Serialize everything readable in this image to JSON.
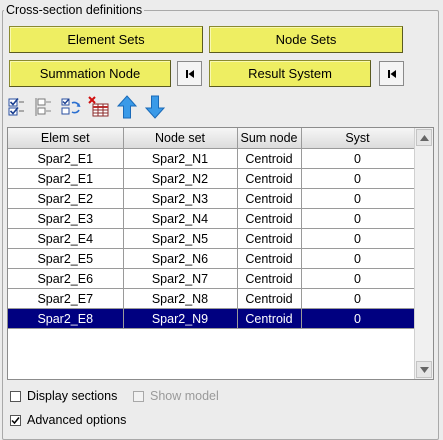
{
  "panel": {
    "title": "Cross-section definitions"
  },
  "buttons": {
    "element_sets": "Element Sets",
    "node_sets": "Node Sets",
    "summation_node": "Summation Node",
    "result_system": "Result System"
  },
  "toolbar": {
    "icons": [
      "check-all-icon",
      "uncheck-all-icon",
      "refresh-icon",
      "delete-table-icon",
      "move-up-icon",
      "move-down-icon"
    ]
  },
  "table": {
    "columns": [
      "Elem set",
      "Node set",
      "Sum node",
      "Syst"
    ],
    "rows": [
      [
        "Spar2_E1",
        "Spar2_N1",
        "Centroid",
        "0"
      ],
      [
        "Spar2_E1",
        "Spar2_N2",
        "Centroid",
        "0"
      ],
      [
        "Spar2_E2",
        "Spar2_N3",
        "Centroid",
        "0"
      ],
      [
        "Spar2_E3",
        "Spar2_N4",
        "Centroid",
        "0"
      ],
      [
        "Spar2_E4",
        "Spar2_N5",
        "Centroid",
        "0"
      ],
      [
        "Spar2_E5",
        "Spar2_N6",
        "Centroid",
        "0"
      ],
      [
        "Spar2_E6",
        "Spar2_N7",
        "Centroid",
        "0"
      ],
      [
        "Spar2_E7",
        "Spar2_N8",
        "Centroid",
        "0"
      ],
      [
        "Spar2_E8",
        "Spar2_N9",
        "Centroid",
        "0"
      ]
    ],
    "selected_row": 8
  },
  "options": {
    "display_sections": "Display sections",
    "show_model": "Show model",
    "advanced_options": "Advanced options"
  },
  "colors": {
    "button_yellow": "#eeee62",
    "selection": "#000080"
  }
}
